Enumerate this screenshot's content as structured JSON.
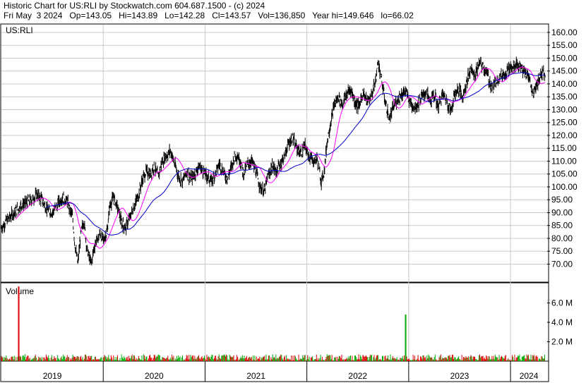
{
  "header": {
    "line1": "Historic Chart for US:RLI by Stockwatch.com 604.687.1500 - (c) 2024",
    "line2": "Fri May  3 2024   Op=143.05   Hi=143.89   Lo=142.28   Cl=143.57   Vol=136,850   Year hi=149.646   lo=66.02"
  },
  "colors": {
    "price": "#000000",
    "ma_short": "#ff00ff",
    "ma_long": "#0000cc",
    "vol_up": "#00aa00",
    "vol_down": "#dd0000",
    "grid": "#c8c8c8"
  },
  "chart_data": [
    {
      "type": "line",
      "title": "US:RLI",
      "ylim": [
        63,
        163
      ],
      "yticks": [
        "160.00",
        "155.00",
        "150.00",
        "145.00",
        "140.00",
        "135.00",
        "130.00",
        "125.00",
        "120.00",
        "115.00",
        "110.00",
        "105.00",
        "100.00",
        "95.00",
        "90.00",
        "85.00",
        "80.00",
        "75.00",
        "70.00"
      ],
      "x_years": [
        "2019",
        "2020",
        "2021",
        "2022",
        "2023",
        "2024"
      ],
      "xlim": [
        2019.0,
        2024.36
      ],
      "series": [],
      "price_close": [
        {
          "x": 2019.0,
          "y": 84
        },
        {
          "x": 2019.05,
          "y": 87
        },
        {
          "x": 2019.1,
          "y": 89
        },
        {
          "x": 2019.15,
          "y": 91
        },
        {
          "x": 2019.2,
          "y": 93
        },
        {
          "x": 2019.25,
          "y": 94
        },
        {
          "x": 2019.3,
          "y": 95
        },
        {
          "x": 2019.35,
          "y": 97
        },
        {
          "x": 2019.4,
          "y": 95
        },
        {
          "x": 2019.45,
          "y": 91
        },
        {
          "x": 2019.5,
          "y": 90
        },
        {
          "x": 2019.55,
          "y": 93
        },
        {
          "x": 2019.6,
          "y": 96
        },
        {
          "x": 2019.65,
          "y": 94
        },
        {
          "x": 2019.7,
          "y": 88
        },
        {
          "x": 2019.72,
          "y": 78
        },
        {
          "x": 2019.75,
          "y": 70
        },
        {
          "x": 2019.78,
          "y": 82
        },
        {
          "x": 2019.81,
          "y": 87
        },
        {
          "x": 2019.84,
          "y": 76
        },
        {
          "x": 2019.88,
          "y": 70
        },
        {
          "x": 2019.92,
          "y": 78
        },
        {
          "x": 2019.97,
          "y": 82
        },
        {
          "x": 2020.0,
          "y": 79
        },
        {
          "x": 2020.04,
          "y": 83
        },
        {
          "x": 2020.06,
          "y": 92
        },
        {
          "x": 2020.1,
          "y": 96
        },
        {
          "x": 2020.14,
          "y": 92
        },
        {
          "x": 2020.18,
          "y": 86
        },
        {
          "x": 2020.22,
          "y": 84
        },
        {
          "x": 2020.26,
          "y": 88
        },
        {
          "x": 2020.3,
          "y": 92
        },
        {
          "x": 2020.34,
          "y": 96
        },
        {
          "x": 2020.38,
          "y": 102
        },
        {
          "x": 2020.42,
          "y": 106
        },
        {
          "x": 2020.46,
          "y": 105
        },
        {
          "x": 2020.5,
          "y": 108
        },
        {
          "x": 2020.54,
          "y": 104
        },
        {
          "x": 2020.58,
          "y": 110
        },
        {
          "x": 2020.62,
          "y": 112
        },
        {
          "x": 2020.66,
          "y": 114
        },
        {
          "x": 2020.7,
          "y": 109
        },
        {
          "x": 2020.74,
          "y": 104
        },
        {
          "x": 2020.78,
          "y": 102
        },
        {
          "x": 2020.82,
          "y": 106
        },
        {
          "x": 2020.86,
          "y": 103
        },
        {
          "x": 2020.9,
          "y": 105
        },
        {
          "x": 2020.94,
          "y": 108
        },
        {
          "x": 2020.98,
          "y": 106
        },
        {
          "x": 2021.02,
          "y": 104
        },
        {
          "x": 2021.06,
          "y": 102
        },
        {
          "x": 2021.1,
          "y": 105
        },
        {
          "x": 2021.14,
          "y": 109
        },
        {
          "x": 2021.18,
          "y": 106
        },
        {
          "x": 2021.22,
          "y": 103
        },
        {
          "x": 2021.26,
          "y": 108
        },
        {
          "x": 2021.3,
          "y": 113
        },
        {
          "x": 2021.34,
          "y": 111
        },
        {
          "x": 2021.38,
          "y": 105
        },
        {
          "x": 2021.42,
          "y": 109
        },
        {
          "x": 2021.46,
          "y": 110
        },
        {
          "x": 2021.5,
          "y": 106
        },
        {
          "x": 2021.54,
          "y": 100
        },
        {
          "x": 2021.58,
          "y": 98
        },
        {
          "x": 2021.62,
          "y": 104
        },
        {
          "x": 2021.66,
          "y": 108
        },
        {
          "x": 2021.7,
          "y": 106
        },
        {
          "x": 2021.74,
          "y": 109
        },
        {
          "x": 2021.78,
          "y": 112
        },
        {
          "x": 2021.82,
          "y": 117
        },
        {
          "x": 2021.86,
          "y": 119
        },
        {
          "x": 2021.9,
          "y": 115
        },
        {
          "x": 2021.94,
          "y": 113
        },
        {
          "x": 2021.98,
          "y": 116
        },
        {
          "x": 2022.02,
          "y": 112
        },
        {
          "x": 2022.06,
          "y": 110
        },
        {
          "x": 2022.1,
          "y": 111
        },
        {
          "x": 2022.14,
          "y": 102
        },
        {
          "x": 2022.17,
          "y": 106
        },
        {
          "x": 2022.2,
          "y": 118
        },
        {
          "x": 2022.23,
          "y": 124
        },
        {
          "x": 2022.27,
          "y": 132
        },
        {
          "x": 2022.31,
          "y": 135
        },
        {
          "x": 2022.35,
          "y": 132
        },
        {
          "x": 2022.39,
          "y": 136
        },
        {
          "x": 2022.43,
          "y": 138
        },
        {
          "x": 2022.47,
          "y": 133
        },
        {
          "x": 2022.51,
          "y": 131
        },
        {
          "x": 2022.55,
          "y": 137
        },
        {
          "x": 2022.59,
          "y": 133
        },
        {
          "x": 2022.63,
          "y": 135
        },
        {
          "x": 2022.67,
          "y": 140
        },
        {
          "x": 2022.7,
          "y": 149
        },
        {
          "x": 2022.73,
          "y": 142
        },
        {
          "x": 2022.77,
          "y": 133
        },
        {
          "x": 2022.81,
          "y": 126
        },
        {
          "x": 2022.85,
          "y": 131
        },
        {
          "x": 2022.89,
          "y": 134
        },
        {
          "x": 2022.93,
          "y": 136
        },
        {
          "x": 2022.97,
          "y": 137
        },
        {
          "x": 2023.01,
          "y": 133
        },
        {
          "x": 2023.05,
          "y": 131
        },
        {
          "x": 2023.09,
          "y": 132
        },
        {
          "x": 2023.13,
          "y": 135
        },
        {
          "x": 2023.17,
          "y": 137
        },
        {
          "x": 2023.21,
          "y": 133
        },
        {
          "x": 2023.25,
          "y": 136
        },
        {
          "x": 2023.29,
          "y": 131
        },
        {
          "x": 2023.33,
          "y": 136
        },
        {
          "x": 2023.37,
          "y": 134
        },
        {
          "x": 2023.41,
          "y": 129
        },
        {
          "x": 2023.45,
          "y": 136
        },
        {
          "x": 2023.49,
          "y": 138
        },
        {
          "x": 2023.53,
          "y": 135
        },
        {
          "x": 2023.57,
          "y": 141
        },
        {
          "x": 2023.61,
          "y": 146
        },
        {
          "x": 2023.65,
          "y": 143
        },
        {
          "x": 2023.69,
          "y": 148
        },
        {
          "x": 2023.73,
          "y": 147
        },
        {
          "x": 2023.77,
          "y": 144
        },
        {
          "x": 2023.8,
          "y": 140
        },
        {
          "x": 2023.83,
          "y": 138
        },
        {
          "x": 2023.86,
          "y": 142
        },
        {
          "x": 2023.9,
          "y": 143
        },
        {
          "x": 2023.94,
          "y": 144
        },
        {
          "x": 2023.98,
          "y": 146
        },
        {
          "x": 2024.02,
          "y": 146
        },
        {
          "x": 2024.06,
          "y": 148
        },
        {
          "x": 2024.1,
          "y": 146
        },
        {
          "x": 2024.14,
          "y": 144
        },
        {
          "x": 2024.18,
          "y": 143
        },
        {
          "x": 2024.22,
          "y": 136
        },
        {
          "x": 2024.26,
          "y": 140
        },
        {
          "x": 2024.3,
          "y": 144
        },
        {
          "x": 2024.34,
          "y": 143.57
        }
      ]
    },
    {
      "type": "bar",
      "title": "Volume",
      "ylim": [
        0,
        8
      ],
      "yticks": [
        "6.0 M",
        "4.0 M",
        "2.0 M"
      ],
      "spikes": [
        {
          "x": 2019.17,
          "y": 7.7,
          "color": "down"
        },
        {
          "x": 2022.97,
          "y": 4.8,
          "color": "up"
        }
      ],
      "baseline_range": [
        0.05,
        0.7
      ]
    }
  ]
}
